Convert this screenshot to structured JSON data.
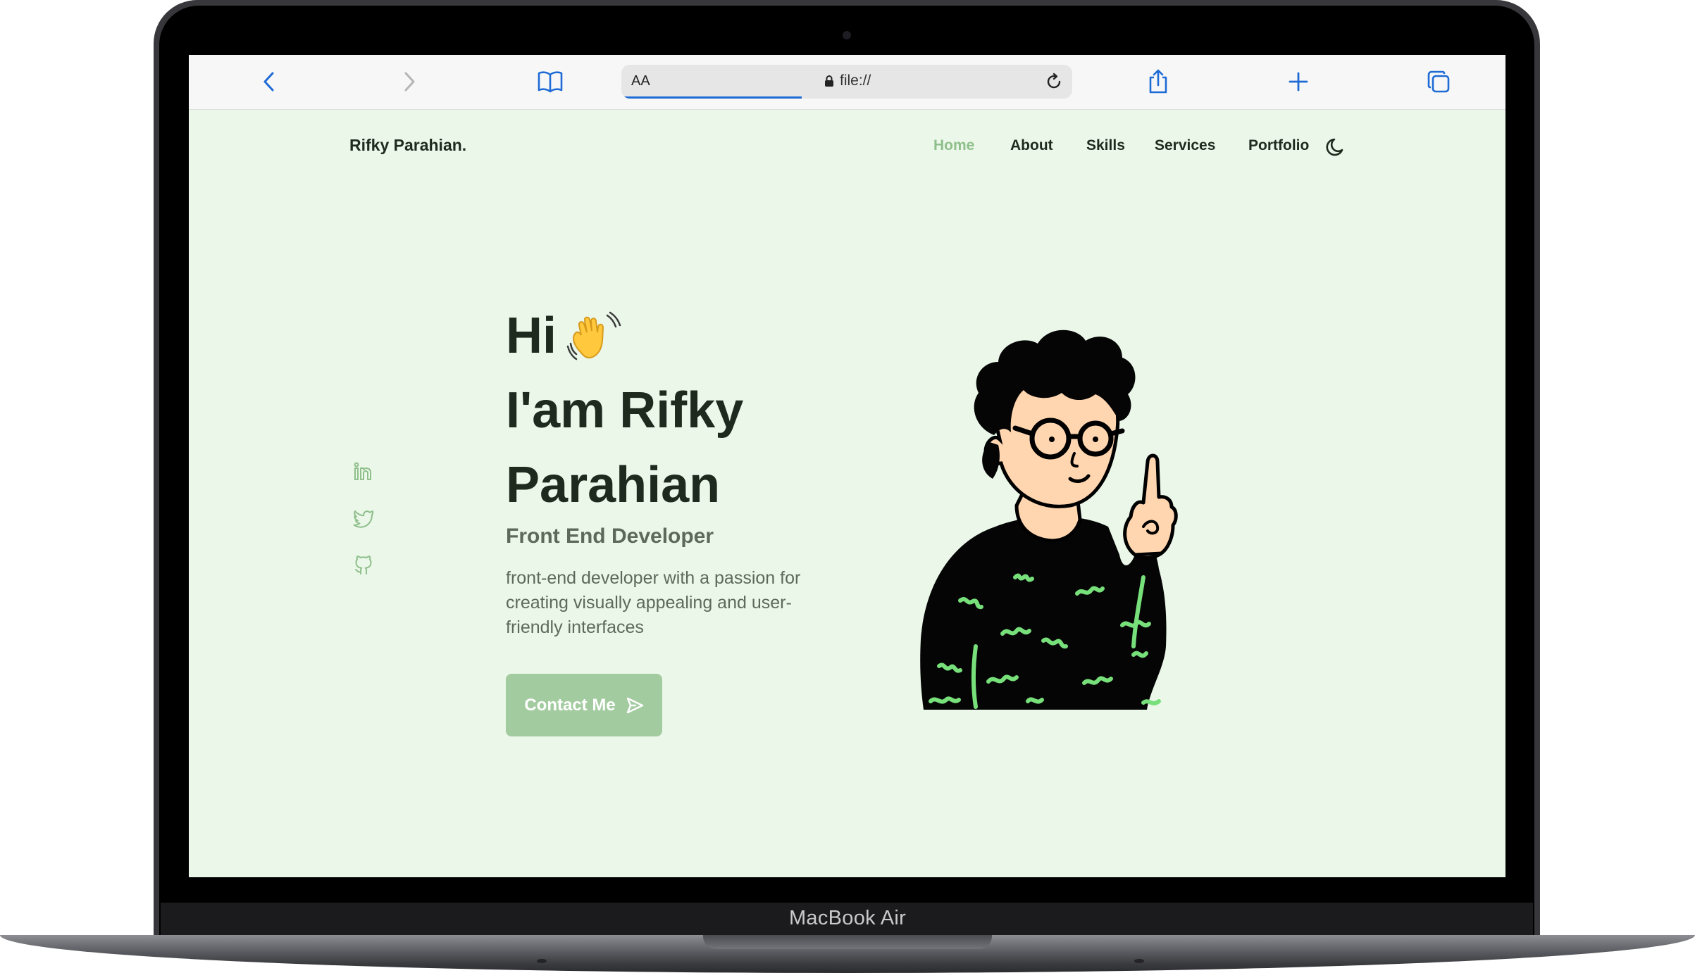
{
  "device": {
    "label": "MacBook Air"
  },
  "browser": {
    "address_aa": "AA",
    "address_url": "file://",
    "progress": 0.4,
    "icons": [
      "back-icon",
      "forward-icon",
      "bookmarks-icon",
      "lock-icon",
      "reload-icon",
      "share-icon",
      "new-tab-icon",
      "tabs-icon"
    ]
  },
  "site": {
    "logo": "Rifky Parahian.",
    "nav": [
      {
        "label": "Home",
        "active": true
      },
      {
        "label": "About",
        "active": false
      },
      {
        "label": "Skills",
        "active": false
      },
      {
        "label": "Services",
        "active": false
      },
      {
        "label": "Portfolio",
        "active": false
      }
    ],
    "social": [
      "linkedin-icon",
      "twitter-icon",
      "github-icon"
    ]
  },
  "hero": {
    "greeting": "Hi",
    "name_line1": "I'am Rifky",
    "name_line2": "Parahian",
    "role": "Front End Developer",
    "description": "front-end developer with a passion for creating visually appealing and user-friendly interfaces",
    "button": "Contact Me"
  },
  "colors": {
    "page_bg": "#eaf7e9",
    "accent": "#a3cba0",
    "nav_active": "#8fbf8a",
    "text_dark": "#1f2a1f",
    "text_muted": "#5d6a5b",
    "browser_blue": "#1e6bd6"
  }
}
